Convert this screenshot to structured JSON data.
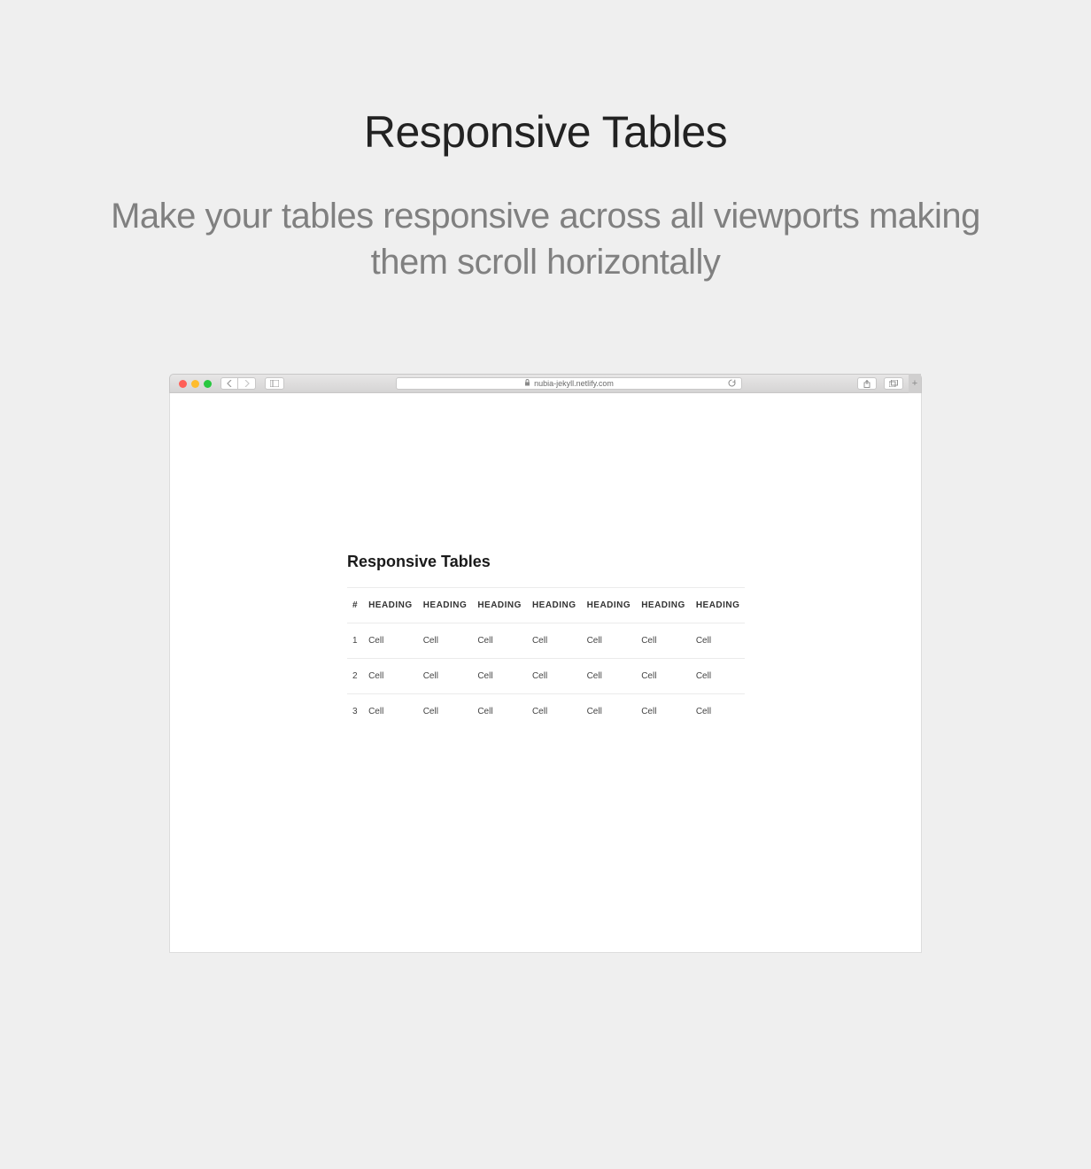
{
  "hero": {
    "title": "Responsive Tables",
    "subtitle": "Make your tables responsive across all viewports making them scroll horizontally"
  },
  "browser": {
    "url": "nubia-jekyll.netlify.com"
  },
  "content": {
    "heading": "Responsive Tables",
    "table": {
      "headers": [
        "#",
        "HEADING",
        "HEADING",
        "HEADING",
        "HEADING",
        "HEADING",
        "HEADING",
        "HEADING"
      ],
      "rows": [
        [
          "1",
          "Cell",
          "Cell",
          "Cell",
          "Cell",
          "Cell",
          "Cell",
          "Cell"
        ],
        [
          "2",
          "Cell",
          "Cell",
          "Cell",
          "Cell",
          "Cell",
          "Cell",
          "Cell"
        ],
        [
          "3",
          "Cell",
          "Cell",
          "Cell",
          "Cell",
          "Cell",
          "Cell",
          "Cell"
        ]
      ]
    }
  }
}
